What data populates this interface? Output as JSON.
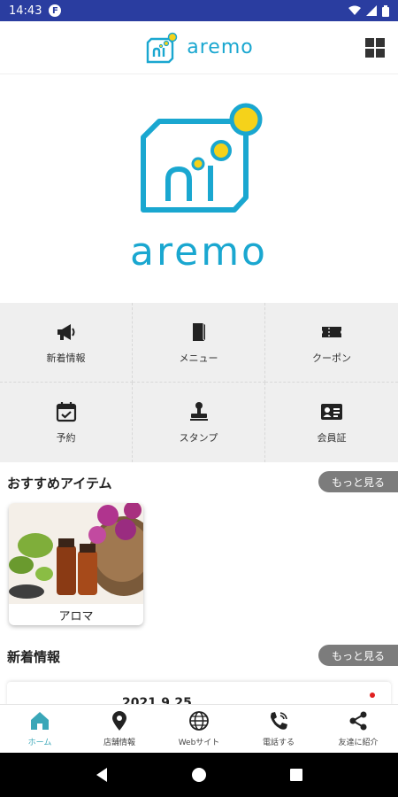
{
  "status_bar": {
    "time": "14:43",
    "app_badge": "F"
  },
  "app_bar": {
    "brand": "aremo",
    "menu_icon": "grid-menu-icon"
  },
  "hero": {
    "brand": "aremo",
    "logo_color": "#1aa7d0",
    "accent_color": "#f5d21a"
  },
  "menu_grid": [
    {
      "label": "新着情報",
      "icon": "megaphone-icon"
    },
    {
      "label": "メニュー",
      "icon": "book-icon"
    },
    {
      "label": "クーポン",
      "icon": "ticket-icon"
    },
    {
      "label": "予約",
      "icon": "calendar-check-icon"
    },
    {
      "label": "スタンプ",
      "icon": "stamp-icon"
    },
    {
      "label": "会員証",
      "icon": "member-card-icon"
    }
  ],
  "recommended": {
    "title": "おすすめアイテム",
    "more_label": "もっと見る",
    "items": [
      {
        "name": "アロマ"
      }
    ]
  },
  "news": {
    "title": "新着情報",
    "more_label": "もっと見る",
    "items": [
      {
        "date": "2021.9.25"
      }
    ]
  },
  "bottom_nav": [
    {
      "label": "ホーム",
      "icon": "home-icon",
      "active": true
    },
    {
      "label": "店舗情報",
      "icon": "location-pin-icon"
    },
    {
      "label": "Webサイト",
      "icon": "globe-icon"
    },
    {
      "label": "電話する",
      "icon": "phone-icon"
    },
    {
      "label": "友達に紹介",
      "icon": "share-icon"
    }
  ],
  "colors": {
    "status_bar": "#2a3da0",
    "brand": "#1aa7d0",
    "active_nav": "#3aa7b8",
    "more_button": "#7c7c7c"
  }
}
